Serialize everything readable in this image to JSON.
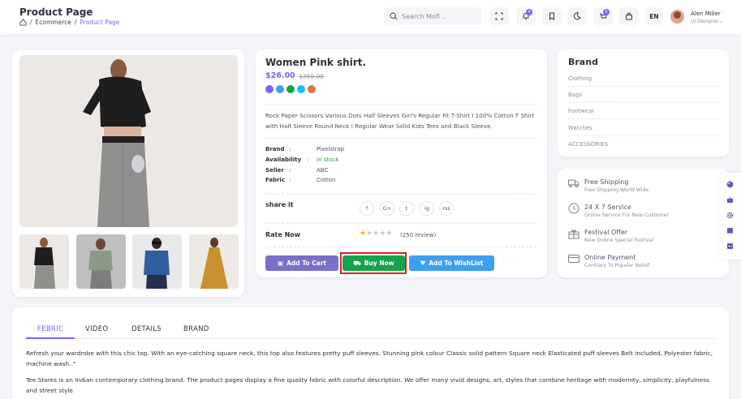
{
  "header": {
    "title": "Product Page",
    "breadcrumb": [
      "Ecommerce",
      "Product Page"
    ],
    "search_placeholder": "Search Mofi ..",
    "notification_count": "4",
    "cart_count": "5",
    "language": "EN",
    "user": {
      "name": "Alen Miller",
      "role": "UI Designer"
    }
  },
  "product": {
    "name": "Women Pink shirt.",
    "price": "$26.00",
    "old_price": "$350.00",
    "colors": [
      "#7366ff",
      "#3d9ff0",
      "#16a34a",
      "#16c2f0",
      "#d97a3a"
    ],
    "description": "Rock Paper Scissors Various Dots Half Sleeves Girl's Regular Fit T-Shirt I 100% Cotton T Shirt with Half Sleeve Round Neck I Regular Wear Solid Kids Tees and Black Sleeve.",
    "specs": [
      {
        "key": "Brand",
        "sep": ":",
        "value": "Pixelstrap"
      },
      {
        "key": "Availability",
        "sep": ":",
        "value": "In stock"
      },
      {
        "key": "Seller",
        "sep": ":",
        "value": "ABC"
      },
      {
        "key": "Fabric",
        "sep": ":",
        "value": "Cotton"
      }
    ],
    "share_label": "share it",
    "social": [
      "f",
      "G+",
      "t",
      "ig",
      "rss"
    ],
    "rate_label": "Rate Now",
    "rating": 1,
    "rating_max": 5,
    "reviews": "(250 review)",
    "buttons": {
      "add_to_cart": "Add To Cart",
      "buy_now": "Buy Now",
      "wishlist": "Add To WishList"
    }
  },
  "brand": {
    "title": "Brand",
    "items": [
      "Clothing",
      "Bags",
      "Footwear",
      "Watches",
      "ACCESSORIES"
    ]
  },
  "services": [
    {
      "icon": "truck-icon",
      "title": "Free Shipping",
      "subtitle": "Free Shipping World Wide"
    },
    {
      "icon": "clock-icon",
      "title": "24 X 7 Service",
      "subtitle": "Online Service For New Customer"
    },
    {
      "icon": "gift-icon",
      "title": "Festival Offer",
      "subtitle": "New Online Special Festival"
    },
    {
      "icon": "credit-card-icon",
      "title": "Online Payment",
      "subtitle": "Contrary To Popular Belief."
    }
  ],
  "tabs": [
    "FEBRIC",
    "VIDEO",
    "DETAILS",
    "BRAND"
  ],
  "tab_content": [
    "Refresh your wardrobe with this chic top. With an eye-catching square neck, this top also features pretty puff sleeves. Stunning pink colour Classic solid pattern Square neck Elasticated puff sleeves Belt included, Polyester fabric, machine wash..\"",
    "Tee Stores is an Indian contemporary clothing brand. The product pages display a fine quality fabric with colorful description. We offer many vivid designs, art, styles that combine heritage with modernity, simplicity, playfulness and street style"
  ],
  "colors": {
    "accent": "#7366ff",
    "buy": "#16a34a",
    "wishlist": "#3d9ff0",
    "cart": "#7a6fc9"
  }
}
